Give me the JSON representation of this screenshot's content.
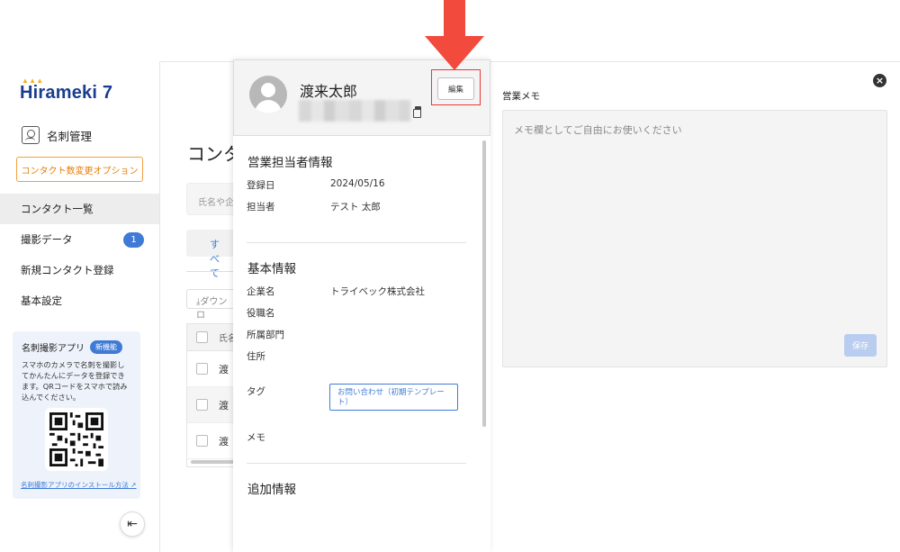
{
  "logo": {
    "text": "Hirameki 7"
  },
  "sidebar": {
    "section_label": "名刺管理",
    "option_button": "コンタクト数変更オプション",
    "nav": [
      {
        "label": "コンタクト一覧",
        "active": true
      },
      {
        "label": "撮影データ",
        "badge": "1"
      },
      {
        "label": "新規コンタクト登録"
      },
      {
        "label": "基本設定"
      }
    ],
    "promo": {
      "title": "名刺撮影アプリ",
      "badge": "新機能",
      "text": "スマホのカメラで名刺を撮影してかんたんにデータを登録できます。QRコードをスマホで読み込んでください。",
      "link": "名刺撮影アプリのインストール方法"
    }
  },
  "main": {
    "title": "コンタ",
    "search_placeholder": "氏名や企",
    "all_button": "すべて",
    "download_label": "ダウンロ",
    "table_header": "氏名",
    "rows": [
      "渡",
      "渡",
      "渡"
    ]
  },
  "detail": {
    "name": "渡来太郎",
    "edit_label": "編集",
    "sales_section": {
      "title": "営業担当者情報",
      "fields": [
        {
          "label": "登録日",
          "value": "2024/05/16"
        },
        {
          "label": "担当者",
          "value": "テスト 太郎"
        }
      ]
    },
    "basic_section": {
      "title": "基本情報",
      "fields": [
        {
          "label": "企業名",
          "value": "トライベック株式会社"
        },
        {
          "label": "役職名",
          "value": ""
        },
        {
          "label": "所属部門",
          "value": ""
        },
        {
          "label": "住所",
          "value": ""
        }
      ],
      "tag_label": "タグ",
      "tag_value": "お問い合わせ（初期テンプレート）",
      "memo_label": "メモ"
    },
    "extra_section": {
      "title": "追加情報"
    }
  },
  "memo": {
    "title": "営業メモ",
    "placeholder": "メモ欄としてご自由にお使いください",
    "save_label": "保存"
  },
  "colors": {
    "accent": "#3f7bd6",
    "option_border": "#f2a13f",
    "annotation": "#e53935",
    "save_disabled": "#b9cdf0"
  },
  "icons": [
    "business-card-icon",
    "copy-icon",
    "close-icon",
    "download-icon",
    "collapse-sidebar-icon",
    "external-link-icon",
    "qr-code",
    "avatar-icon",
    "down-arrow-annotation"
  ]
}
